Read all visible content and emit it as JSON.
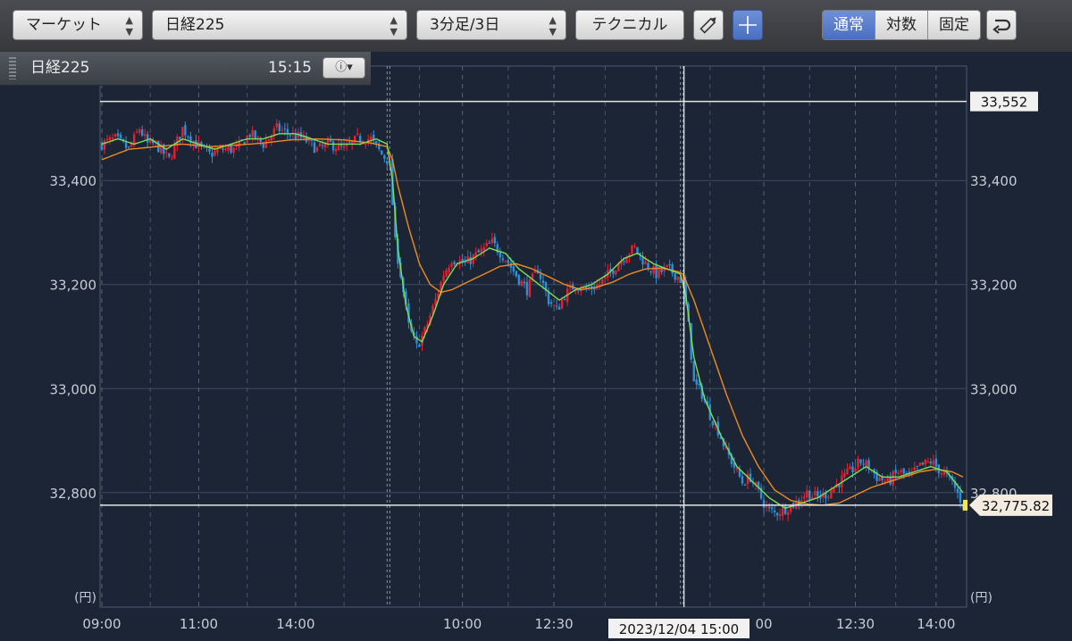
{
  "toolbar": {
    "market_select": "マーケット",
    "symbol_select": "日経225",
    "interval_select": "3分足/3日",
    "technical_button": "テクニカル",
    "scale_modes": [
      "通常",
      "対数",
      "固定"
    ],
    "active_scale_mode": "通常"
  },
  "info_bar": {
    "symbol": "日経225",
    "time": "15:15"
  },
  "crosshair": {
    "date_label": "2023/12/04 15:00"
  },
  "price_labels": {
    "high_line": "33,552",
    "last_price": "32,775.82",
    "high_value": 33552,
    "last_value": 32775.82
  },
  "colors": {
    "background": "#1b2535",
    "up": "#e8202e",
    "down": "#2f8fd6",
    "ma_short": "#7be05a",
    "ma_long": "#f08a24",
    "grid": "#3c4a60"
  },
  "chart_data": {
    "type": "candlestick",
    "unit_label": "(円)",
    "ylim": [
      32580,
      33620
    ],
    "yticks": [
      32800,
      33000,
      33200,
      33400
    ],
    "ytick_labels": [
      "32,800",
      "33,000",
      "33,200",
      "33,400"
    ],
    "xtick_labels": [
      "09:00",
      "11:00",
      "14:00",
      "10:00",
      "12:30",
      "1",
      "00",
      "12:30",
      "14:00"
    ],
    "day_boundaries_index": [
      0,
      107,
      216
    ],
    "sessions": [
      {
        "start": 0,
        "length": 107
      },
      {
        "start": 107,
        "length": 109
      },
      {
        "start": 216,
        "length": 105
      }
    ],
    "close_path": [
      [
        0,
        33470
      ],
      [
        5,
        33480
      ],
      [
        10,
        33460
      ],
      [
        14,
        33500
      ],
      [
        17,
        33470
      ],
      [
        20,
        33470
      ],
      [
        25,
        33440
      ],
      [
        30,
        33500
      ],
      [
        35,
        33470
      ],
      [
        40,
        33450
      ],
      [
        45,
        33460
      ],
      [
        50,
        33460
      ],
      [
        55,
        33490
      ],
      [
        60,
        33470
      ],
      [
        65,
        33500
      ],
      [
        70,
        33490
      ],
      [
        75,
        33480
      ],
      [
        80,
        33460
      ],
      [
        85,
        33470
      ],
      [
        90,
        33460
      ],
      [
        95,
        33480
      ],
      [
        100,
        33480
      ],
      [
        104,
        33450
      ],
      [
        106,
        33440
      ],
      [
        107,
        33430
      ],
      [
        109,
        33280
      ],
      [
        111,
        33220
      ],
      [
        114,
        33120
      ],
      [
        117,
        33080
      ],
      [
        120,
        33110
      ],
      [
        124,
        33170
      ],
      [
        127,
        33220
      ],
      [
        130,
        33250
      ],
      [
        135,
        33240
      ],
      [
        140,
        33260
      ],
      [
        145,
        33280
      ],
      [
        150,
        33250
      ],
      [
        155,
        33210
      ],
      [
        158,
        33190
      ],
      [
        162,
        33230
      ],
      [
        166,
        33170
      ],
      [
        169,
        33150
      ],
      [
        172,
        33180
      ],
      [
        176,
        33200
      ],
      [
        180,
        33190
      ],
      [
        185,
        33200
      ],
      [
        190,
        33230
      ],
      [
        195,
        33260
      ],
      [
        198,
        33270
      ],
      [
        202,
        33240
      ],
      [
        206,
        33220
      ],
      [
        210,
        33230
      ],
      [
        213,
        33220
      ],
      [
        215,
        33210
      ],
      [
        216,
        33200
      ],
      [
        218,
        33120
      ],
      [
        220,
        33010
      ],
      [
        223,
        32990
      ],
      [
        226,
        32950
      ],
      [
        229,
        32920
      ],
      [
        232,
        32880
      ],
      [
        235,
        32850
      ],
      [
        238,
        32820
      ],
      [
        241,
        32830
      ],
      [
        244,
        32800
      ],
      [
        247,
        32770
      ],
      [
        250,
        32760
      ],
      [
        254,
        32770
      ],
      [
        258,
        32780
      ],
      [
        262,
        32800
      ],
      [
        266,
        32790
      ],
      [
        270,
        32800
      ],
      [
        274,
        32820
      ],
      [
        278,
        32840
      ],
      [
        282,
        32860
      ],
      [
        285,
        32850
      ],
      [
        288,
        32830
      ],
      [
        292,
        32820
      ],
      [
        296,
        32840
      ],
      [
        300,
        32830
      ],
      [
        304,
        32850
      ],
      [
        308,
        32860
      ],
      [
        312,
        32840
      ],
      [
        316,
        32820
      ],
      [
        320,
        32776
      ]
    ],
    "ma_short": [
      [
        0,
        33470
      ],
      [
        6,
        33480
      ],
      [
        12,
        33470
      ],
      [
        18,
        33480
      ],
      [
        24,
        33460
      ],
      [
        30,
        33480
      ],
      [
        36,
        33470
      ],
      [
        42,
        33460
      ],
      [
        48,
        33470
      ],
      [
        54,
        33480
      ],
      [
        60,
        33480
      ],
      [
        66,
        33490
      ],
      [
        72,
        33490
      ],
      [
        78,
        33480
      ],
      [
        84,
        33470
      ],
      [
        90,
        33470
      ],
      [
        96,
        33470
      ],
      [
        102,
        33480
      ],
      [
        106,
        33470
      ],
      [
        108,
        33400
      ],
      [
        110,
        33270
      ],
      [
        113,
        33160
      ],
      [
        116,
        33100
      ],
      [
        119,
        33090
      ],
      [
        123,
        33140
      ],
      [
        127,
        33200
      ],
      [
        132,
        33240
      ],
      [
        138,
        33250
      ],
      [
        144,
        33270
      ],
      [
        150,
        33260
      ],
      [
        155,
        33230
      ],
      [
        160,
        33210
      ],
      [
        165,
        33190
      ],
      [
        170,
        33170
      ],
      [
        176,
        33190
      ],
      [
        182,
        33200
      ],
      [
        188,
        33220
      ],
      [
        194,
        33250
      ],
      [
        199,
        33260
      ],
      [
        205,
        33240
      ],
      [
        210,
        33230
      ],
      [
        215,
        33220
      ],
      [
        217,
        33180
      ],
      [
        220,
        33060
      ],
      [
        224,
        32980
      ],
      [
        230,
        32910
      ],
      [
        236,
        32850
      ],
      [
        242,
        32820
      ],
      [
        248,
        32790
      ],
      [
        254,
        32770
      ],
      [
        260,
        32780
      ],
      [
        266,
        32790
      ],
      [
        272,
        32810
      ],
      [
        278,
        32830
      ],
      [
        284,
        32850
      ],
      [
        290,
        32830
      ],
      [
        296,
        32830
      ],
      [
        302,
        32840
      ],
      [
        308,
        32850
      ],
      [
        314,
        32840
      ],
      [
        320,
        32800
      ]
    ],
    "ma_long": [
      [
        0,
        33440
      ],
      [
        10,
        33460
      ],
      [
        20,
        33465
      ],
      [
        30,
        33470
      ],
      [
        40,
        33465
      ],
      [
        50,
        33468
      ],
      [
        60,
        33472
      ],
      [
        70,
        33478
      ],
      [
        80,
        33480
      ],
      [
        90,
        33478
      ],
      [
        100,
        33472
      ],
      [
        106,
        33465
      ],
      [
        108,
        33440
      ],
      [
        110,
        33390
      ],
      [
        114,
        33310
      ],
      [
        118,
        33240
      ],
      [
        122,
        33200
      ],
      [
        126,
        33185
      ],
      [
        130,
        33190
      ],
      [
        136,
        33205
      ],
      [
        142,
        33220
      ],
      [
        148,
        33235
      ],
      [
        154,
        33240
      ],
      [
        160,
        33230
      ],
      [
        166,
        33215
      ],
      [
        172,
        33200
      ],
      [
        178,
        33190
      ],
      [
        184,
        33195
      ],
      [
        190,
        33205
      ],
      [
        196,
        33220
      ],
      [
        202,
        33230
      ],
      [
        208,
        33232
      ],
      [
        214,
        33225
      ],
      [
        216,
        33220
      ],
      [
        220,
        33170
      ],
      [
        226,
        33080
      ],
      [
        232,
        32990
      ],
      [
        238,
        32910
      ],
      [
        244,
        32850
      ],
      [
        250,
        32805
      ],
      [
        256,
        32785
      ],
      [
        262,
        32778
      ],
      [
        268,
        32776
      ],
      [
        274,
        32780
      ],
      [
        280,
        32795
      ],
      [
        286,
        32810
      ],
      [
        292,
        32820
      ],
      [
        298,
        32830
      ],
      [
        304,
        32840
      ],
      [
        310,
        32845
      ],
      [
        316,
        32840
      ],
      [
        320,
        32830
      ]
    ]
  }
}
